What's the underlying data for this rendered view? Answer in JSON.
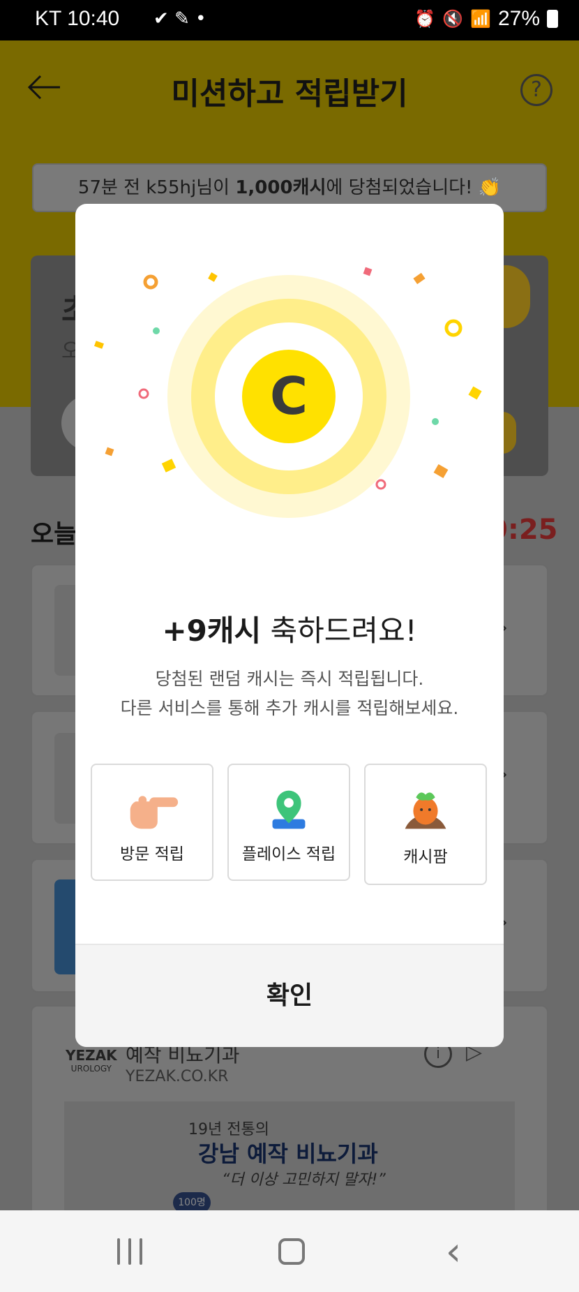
{
  "status_bar": {
    "carrier_time": "KT 10:40",
    "battery": "27%",
    "icons": [
      "check-icon",
      "pencil-icon",
      "dot-icon",
      "alarm-icon",
      "mute-icon",
      "wifi-icon",
      "hd-icon",
      "signal-icon",
      "battery-icon"
    ]
  },
  "header": {
    "title": "미션하고 적립받기",
    "back_icon": "arrow-left-icon",
    "help_icon": "help-icon",
    "help_glyph": "?"
  },
  "ticker": {
    "prefix": "57분 전 k55hj님이 ",
    "amount": "1,000캐시",
    "suffix": "에 당첨되었습니다! 👏"
  },
  "background": {
    "banner_title": "초",
    "banner_sub": "오",
    "section_title": "오늘",
    "timer": "0:25",
    "ad": {
      "title": "예작 비뇨기과",
      "url": "YEZAK.CO.KR",
      "logo": "YEZAK",
      "logo_sub": "UROLOGY",
      "image_line1": "19년 전통의",
      "image_line2": "강남 예작 비뇨기과",
      "image_line3": "“더 이상 고민하지 말자!”",
      "image_badge": "100명"
    }
  },
  "modal": {
    "reward": "+9캐시",
    "congrats": " 축하드려요!",
    "desc_line1": "당첨된 랜덤 캐시는 즉시 적립됩니다.",
    "desc_line2": "다른 서비스를 통해 추가 캐시를 적립해보세요.",
    "coin_letter": "C",
    "options": [
      {
        "label": "방문 적립",
        "icon": "pointing-hand-icon"
      },
      {
        "label": "플레이스 적립",
        "icon": "map-pin-icon"
      },
      {
        "label": "캐시팜",
        "icon": "carrot-icon"
      }
    ],
    "confirm_label": "확인"
  },
  "nav": {
    "recent": "recent-apps-icon",
    "home": "home-icon",
    "back": "back-icon",
    "back_glyph": "‹"
  },
  "colors": {
    "accent_yellow": "#FFE100",
    "dim_overlay_header": "#7A6A00",
    "confirm_bg": "#F4F4F4"
  }
}
